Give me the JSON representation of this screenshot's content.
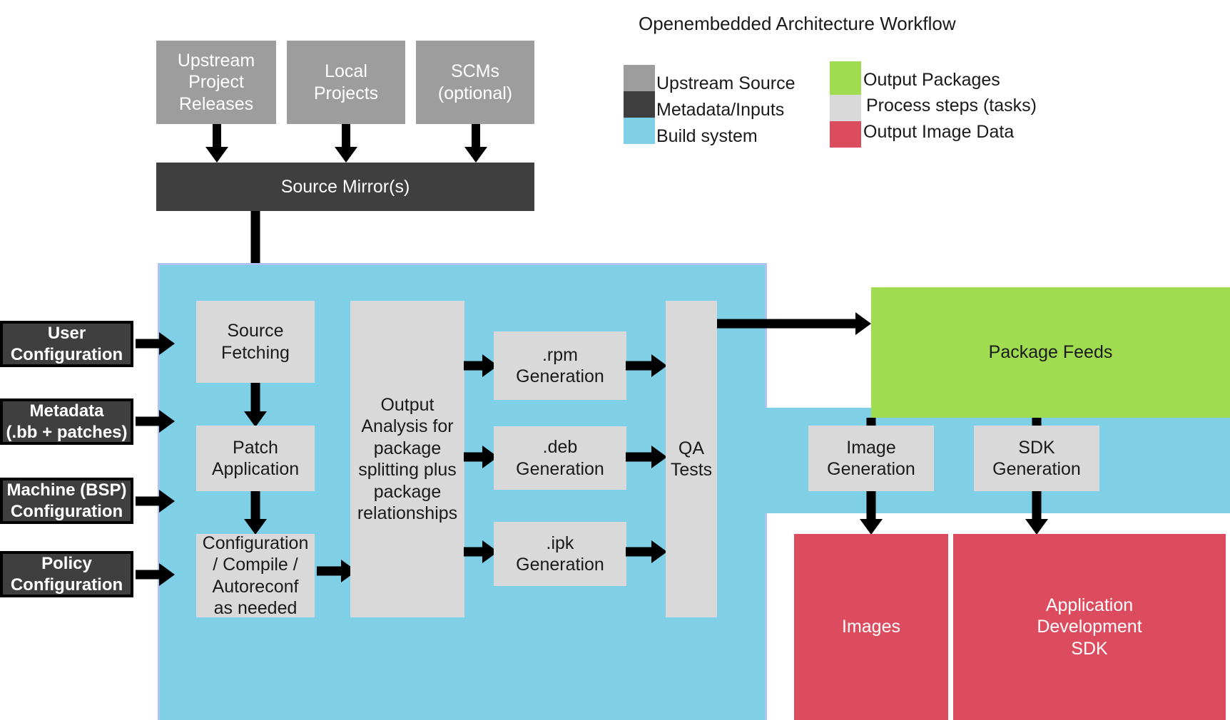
{
  "title": "Openembedded Architecture Workflow",
  "colors": {
    "upstream_source": "#9d9d9d",
    "metadata_inputs": "#3f3f3f",
    "build_system": "#7fd0e6",
    "output_packages": "#a0dc50",
    "process_steps": "#d9d9d9",
    "output_image_data": "#dd4b5e",
    "arrow": "#000000",
    "build_system_border": "#aec3f2"
  },
  "legend": {
    "left_column": [
      {
        "label": "Upstream Source",
        "swatch": "#9d9d9d"
      },
      {
        "label": "Metadata/Inputs",
        "swatch": "#3f3f3f"
      },
      {
        "label": "Build system",
        "swatch": "#7fd0e6"
      }
    ],
    "right_column": [
      {
        "label": "Output Packages",
        "swatch": "#a0dc50"
      },
      {
        "label": "Process steps (tasks)",
        "swatch": "#d9d9d9"
      },
      {
        "label": "Output Image Data",
        "swatch": "#dd4b5e"
      }
    ]
  },
  "sources": [
    {
      "label": "Upstream\nProject\nReleases"
    },
    {
      "label": "Local\nProjects"
    },
    {
      "label": "SCMs\n(optional)"
    }
  ],
  "source_mirror": {
    "label": "Source Mirror(s)"
  },
  "inputs": [
    {
      "label": "User\nConfiguration"
    },
    {
      "label": "Metadata\n(.bb + patches)"
    },
    {
      "label": "Machine (BSP)\nConfiguration"
    },
    {
      "label": "Policy\nConfiguration"
    }
  ],
  "build_pipeline": {
    "stages": [
      {
        "label": "Source\nFetching"
      },
      {
        "label": "Patch\nApplication"
      },
      {
        "label": "Configuration\n/ Compile /\nAutoreconf\nas needed"
      }
    ],
    "analysis": {
      "label": "Output\nAnalysis for\npackage\nsplitting plus\npackage\nrelationships"
    },
    "generation": [
      {
        "label": ".rpm\nGeneration"
      },
      {
        "label": ".deb\nGeneration"
      },
      {
        "label": ".ipk\nGeneration"
      }
    ],
    "qa": {
      "label": "QA\nTests"
    }
  },
  "outputs": {
    "package_feeds": {
      "label": "Package Feeds"
    },
    "image_generation": {
      "label": "Image\nGeneration"
    },
    "sdk_generation": {
      "label": "SDK\nGeneration"
    },
    "images": {
      "label": "Images"
    },
    "app_dev_sdk": {
      "label": "Application\nDevelopment\nSDK"
    }
  }
}
